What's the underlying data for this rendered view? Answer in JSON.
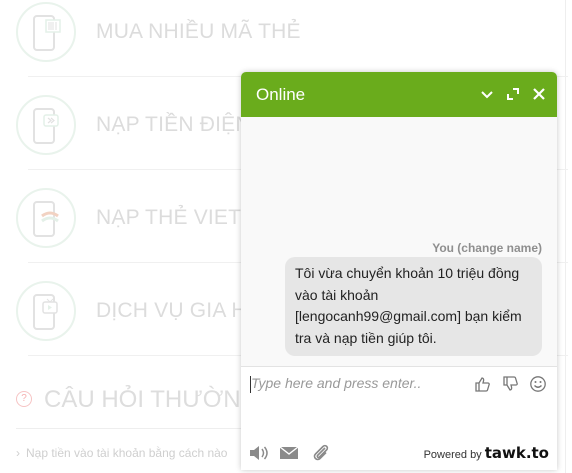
{
  "background": {
    "services": [
      {
        "label": "MUA NHIỀU MÃ THẺ",
        "icon": "barcode-phone-icon"
      },
      {
        "label": "NẠP TIỀN ĐIỆN",
        "icon": "phone-chat-icon"
      },
      {
        "label": "NẠP THẺ VIETT",
        "icon": "phone-card-icon"
      },
      {
        "label": "DỊCH VỤ GIA HẠ",
        "icon": "phone-tv-icon"
      }
    ],
    "faq_title": "CÂU HỎI THƯỜN",
    "faq_item": "Nạp tiền vào tài khoản bằng cách nào"
  },
  "chat": {
    "title": "Online",
    "header_buttons": [
      "minimize-icon",
      "popout-icon",
      "close-icon"
    ],
    "sender_label": "You (change name)",
    "message": "Tôi vừa chuyển khoản 10 triệu đồng vào tài khoản [lengocanh99@gmail.com] bạn kiểm tra và nạp tiền giúp tôi.",
    "input_placeholder": "Type here and press enter..",
    "powered_by": "Powered by",
    "brand": "tawk.to",
    "colors": {
      "header": "#6aac1c",
      "bubble": "#e6e6e6"
    }
  }
}
